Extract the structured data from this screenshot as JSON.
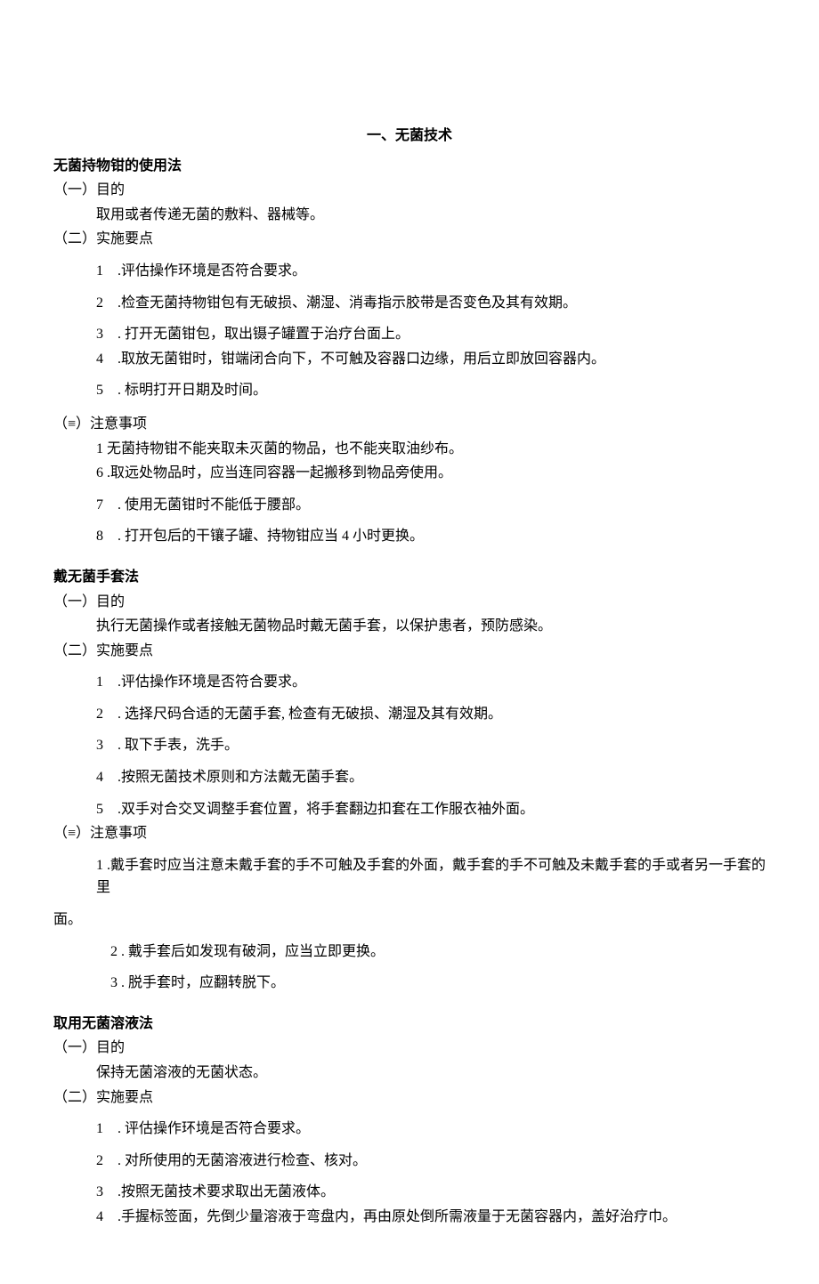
{
  "title": "一、无菌技术",
  "sections": [
    {
      "title": "无菌持物钳的使用法",
      "parts": [
        {
          "heading": "（一）目的",
          "intro": "取用或者传递无菌的敷料、器械等。"
        },
        {
          "heading": "（二）实施要点",
          "items": [
            {
              "num": "1",
              "sep": " .",
              "text": "评估操作环境是否符合要求。"
            },
            {
              "num": "2",
              "sep": " .",
              "text": "检查无菌持物钳包有无破损、潮湿、消毒指示胶带是否变色及其有效期。"
            },
            {
              "num": "3",
              "sep": " . ",
              "text": "打开无菌钳包，取出镊子罐置于治疗台面上。"
            },
            {
              "num": "4",
              "sep": " .",
              "text": "取放无菌钳时，钳端闭合向下，不可触及容器口边缘，用后立即放回容器内。"
            },
            {
              "num": "5",
              "sep": " . ",
              "text": "标明打开日期及时间。"
            }
          ]
        },
        {
          "heading": "（≡）注意事项",
          "items": [
            {
              "num": "1",
              "sep": " ",
              "text": "无菌持物钳不能夹取未灭菌的物品，也不能夹取油纱布。",
              "lead": true
            },
            {
              "num": "6",
              "sep": " .",
              "text": "取远处物品时，应当连同容器一起搬移到物品旁使用。",
              "lead": true
            },
            {
              "num": "7",
              "sep": " . ",
              "text": "使用无菌钳时不能低于腰部。"
            },
            {
              "num": "8",
              "sep": " . ",
              "text": "打开包后的干镶子罐、持物钳应当 4 小时更换。"
            }
          ]
        }
      ]
    },
    {
      "title": "戴无菌手套法",
      "parts": [
        {
          "heading": "（一）目的",
          "intro": "执行无菌操作或者接触无菌物品时戴无菌手套，以保护患者，预防感染。"
        },
        {
          "heading": "（二）实施要点",
          "items": [
            {
              "num": "1",
              "sep": " .",
              "text": "评估操作环境是否符合要求。"
            },
            {
              "num": "2",
              "sep": " . ",
              "text": "选择尺码合适的无菌手套, 检查有无破损、潮湿及其有效期。"
            },
            {
              "num": "3",
              "sep": " . ",
              "text": "取下手表，洗手。"
            },
            {
              "num": "4",
              "sep": " .",
              "text": "按照无菌技术原则和方法戴无菌手套。"
            },
            {
              "num": "5",
              "sep": " .",
              "text": "双手对合交叉调整手套位置，将手套翻边扣套在工作服衣袖外面。",
              "tight": true
            }
          ]
        },
        {
          "heading": "（≡）注意事项",
          "wrap_item": {
            "num": "1",
            "sep": " .",
            "text": "戴手套时应当注意未戴手套的手不可触及手套的外面，戴手套的手不可触及未戴手套的手或者另一手套的里",
            "cont": "面。"
          },
          "wide_items": [
            {
              "num": "2",
              "sep": "     . ",
              "text": "戴手套后如发现有破洞，应当立即更换。"
            },
            {
              "num": "3",
              "sep": "     . ",
              "text": "脱手套时，应翻转脱下。"
            }
          ]
        }
      ]
    },
    {
      "title": "取用无菌溶液法",
      "parts": [
        {
          "heading": "（一）目的",
          "intro": "保持无菌溶液的无菌状态。"
        },
        {
          "heading": "（二）实施要点",
          "items": [
            {
              "num": "1",
              "sep": " . ",
              "text": "评估操作环境是否符合要求。"
            },
            {
              "num": "2",
              "sep": " . ",
              "text": "对所使用的无菌溶液进行检查、核对。"
            },
            {
              "num": "3",
              "sep": " .",
              "text": "按照无菌技术要求取出无菌液体。",
              "tight": true
            },
            {
              "num": "4",
              "sep": " .",
              "text": "手握标签面，先倒少量溶液于弯盘内，再由原处倒所需液量于无菌容器内，盖好治疗巾。",
              "tight": true
            }
          ]
        }
      ]
    }
  ]
}
